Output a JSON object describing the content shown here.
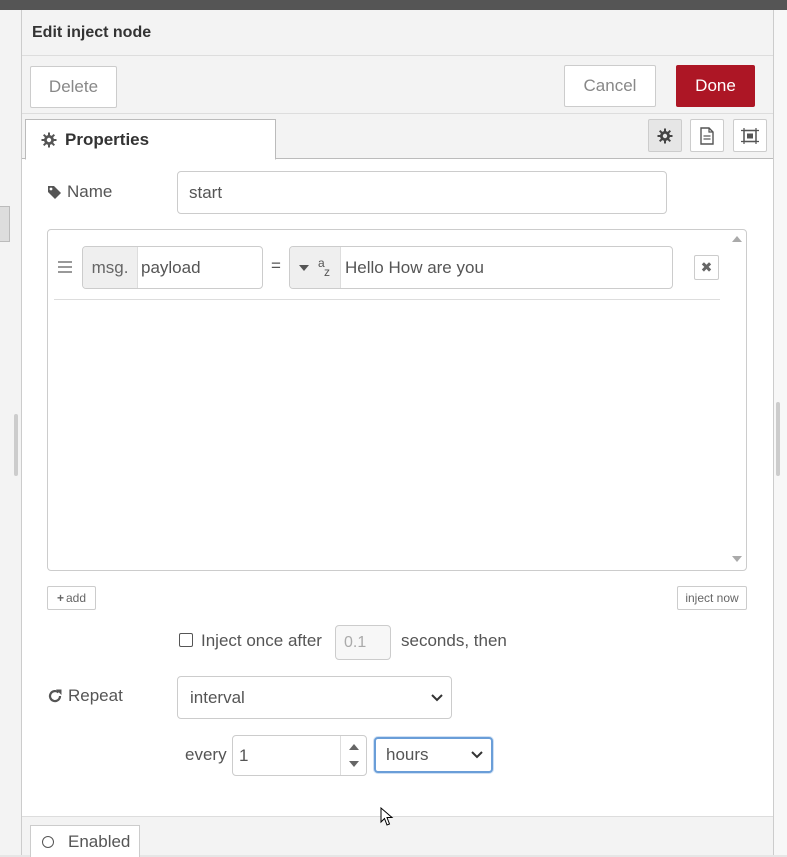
{
  "dialog": {
    "title": "Edit inject node",
    "delete_label": "Delete",
    "cancel_label": "Cancel",
    "done_label": "Done",
    "done_color": "#ad1625"
  },
  "tabs": {
    "properties_label": "Properties",
    "icons": [
      "gear-icon",
      "document-icon",
      "frame-icon"
    ]
  },
  "form": {
    "name_label": "Name",
    "name_value": "start",
    "properties": [
      {
        "prefix": "msg.",
        "property": "payload",
        "operator": "=",
        "type_icon": "az-string-icon",
        "value": "Hello How are you"
      }
    ],
    "add_label": "add",
    "inject_now_label": "inject now",
    "inject_once_checked": false,
    "inject_once_label": "Inject once after",
    "inject_once_delay": "0.1",
    "inject_once_suffix": "seconds, then",
    "repeat_label": "Repeat",
    "repeat_value": "interval",
    "every_label": "every",
    "every_value": "1",
    "units_value": "hours"
  },
  "footer": {
    "enabled_label": "Enabled"
  }
}
